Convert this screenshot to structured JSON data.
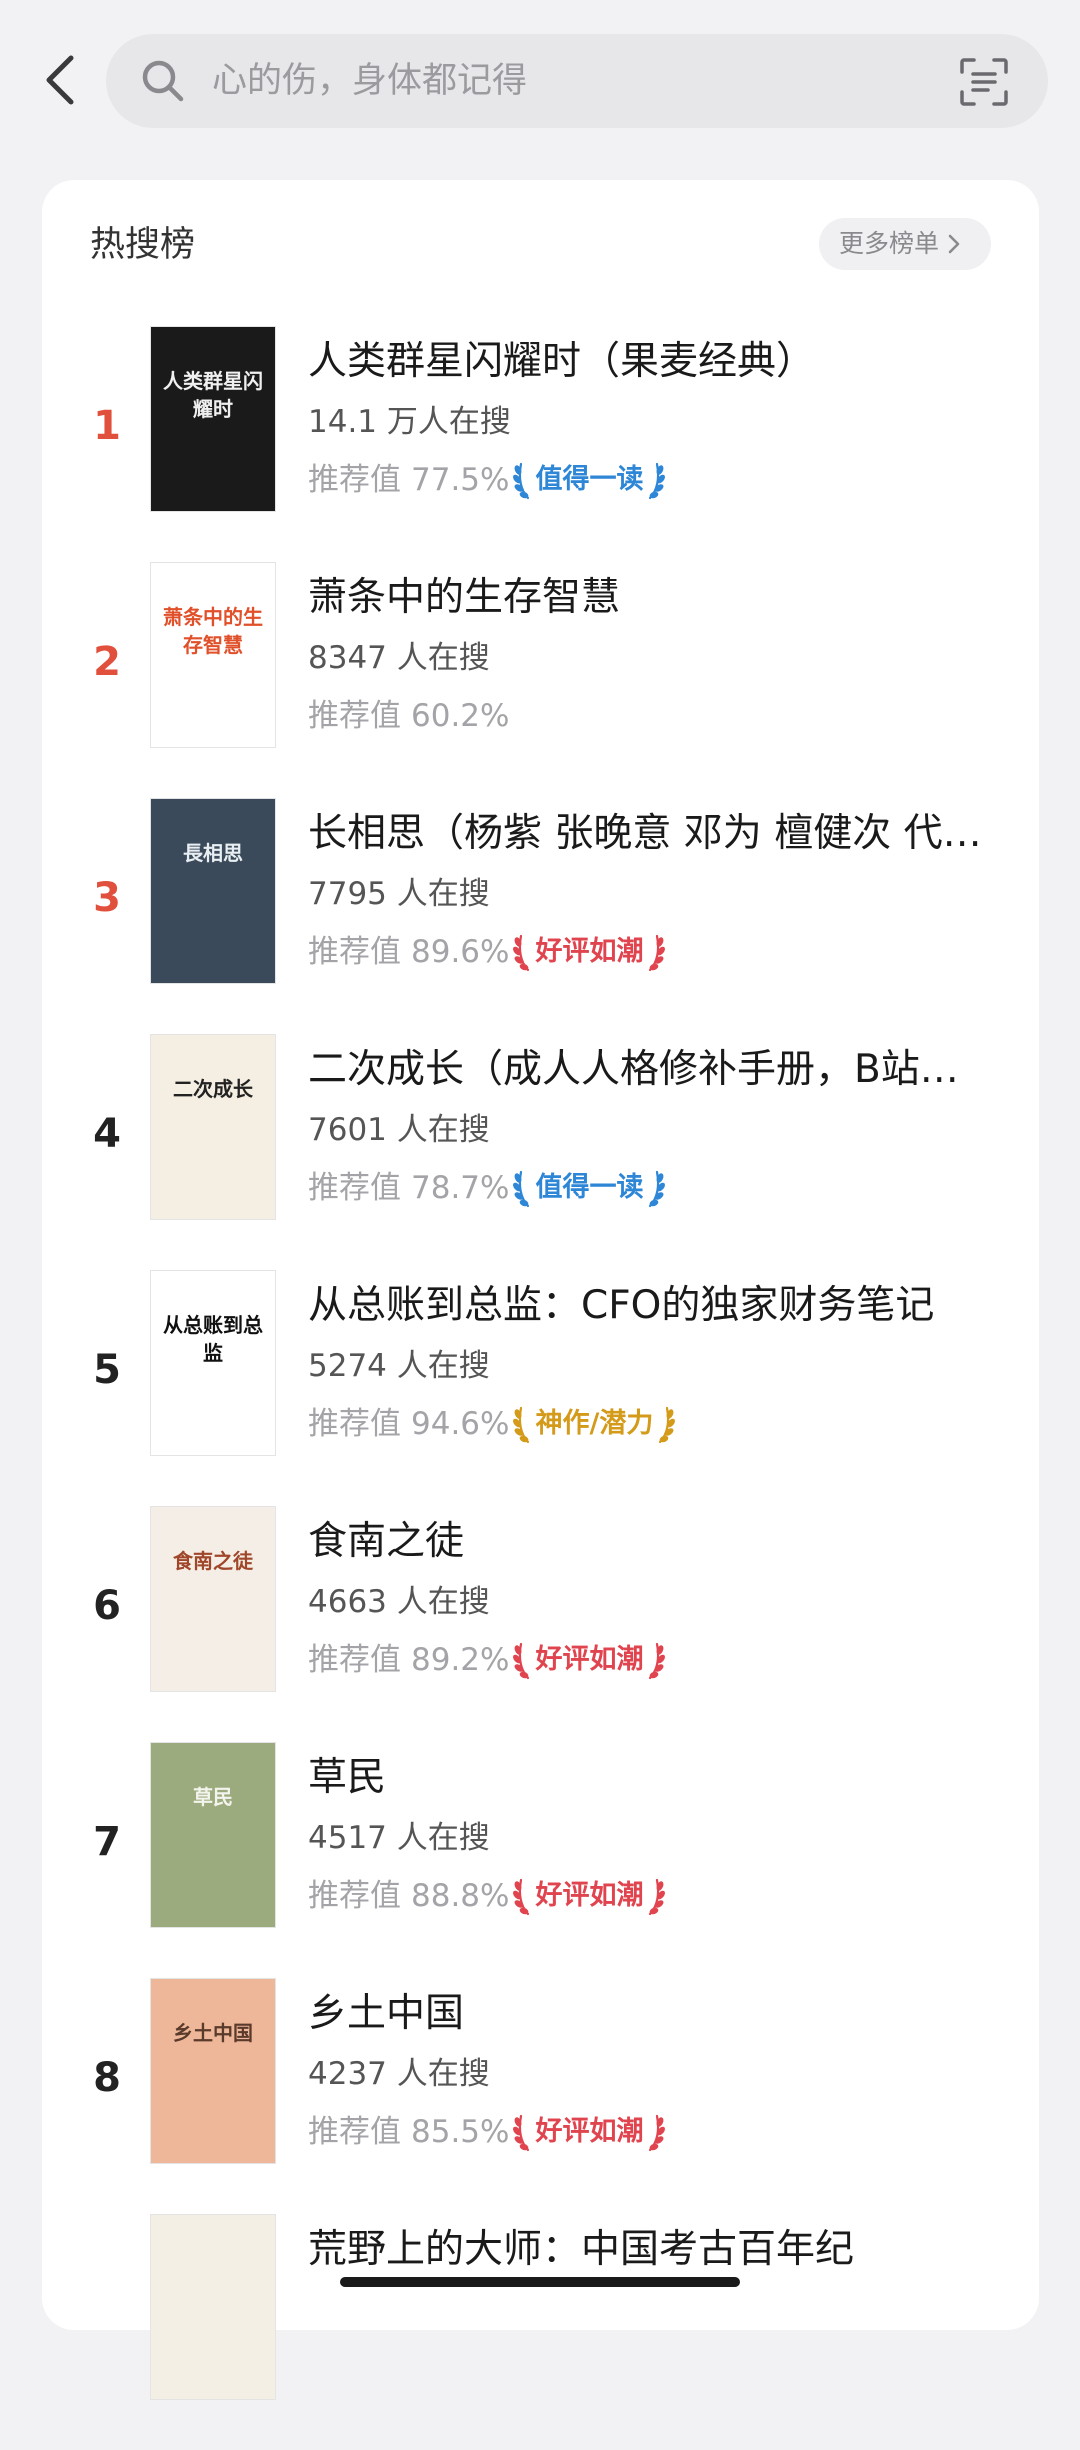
{
  "search": {
    "placeholder": "心的伤，身体都记得",
    "icons": {
      "back": "chevron-left-icon",
      "search": "search-icon",
      "scan": "scan-icon"
    }
  },
  "panel": {
    "title": "热搜榜",
    "more_label": "更多榜单"
  },
  "colors": {
    "top_rank": "#e0503c",
    "rank": "#222222",
    "badge_worth_reading": "#2e86d6",
    "badge_good_reviews": "#e0454f",
    "badge_masterpiece": "#d49a1a"
  },
  "books": [
    {
      "rank": "1",
      "title": "人类群星闪耀时（果麦经典）",
      "count": "14.1 万人在搜",
      "rec_label": "推荐值",
      "rec_value": "77.5%",
      "badge": "值得一读",
      "badge_color": "#2e86d6",
      "cover_text": "人类群星闪耀时",
      "cover_bg": "#1a1a1a",
      "cover_fg": "#f0f0f0"
    },
    {
      "rank": "2",
      "title": "萧条中的生存智慧",
      "count": "8347 人在搜",
      "rec_label": "推荐值",
      "rec_value": "60.2%",
      "badge": "",
      "badge_color": "",
      "cover_text": "萧条中的生存智慧",
      "cover_bg": "#ffffff",
      "cover_fg": "#e0502a"
    },
    {
      "rank": "3",
      "title": "长相思（杨紫 张晚意 邓为 檀健次 代…",
      "count": "7795 人在搜",
      "rec_label": "推荐值",
      "rec_value": "89.6%",
      "badge": "好评如潮",
      "badge_color": "#e0454f",
      "cover_text": "長相思",
      "cover_bg": "#3b4a5a",
      "cover_fg": "#e8eef2"
    },
    {
      "rank": "4",
      "title": "二次成长（成人人格修补手册，B站…",
      "count": "7601 人在搜",
      "rec_label": "推荐值",
      "rec_value": "78.7%",
      "badge": "值得一读",
      "badge_color": "#2e86d6",
      "cover_text": "二次成长",
      "cover_bg": "#f4efe2",
      "cover_fg": "#222222"
    },
    {
      "rank": "5",
      "title": "从总账到总监：CFO的独家财务笔记",
      "count": "5274 人在搜",
      "rec_label": "推荐值",
      "rec_value": "94.6%",
      "badge": "神作/潜力",
      "badge_color": "#d49a1a",
      "cover_text": "从总账到总监",
      "cover_bg": "#ffffff",
      "cover_fg": "#111111"
    },
    {
      "rank": "6",
      "title": "食南之徒",
      "count": "4663 人在搜",
      "rec_label": "推荐值",
      "rec_value": "89.2%",
      "badge": "好评如潮",
      "badge_color": "#e0454f",
      "cover_text": "食南之徒",
      "cover_bg": "#f4eee6",
      "cover_fg": "#a0462a"
    },
    {
      "rank": "7",
      "title": "草民",
      "count": "4517 人在搜",
      "rec_label": "推荐值",
      "rec_value": "88.8%",
      "badge": "好评如潮",
      "badge_color": "#e0454f",
      "cover_text": "草民",
      "cover_bg": "#9cab7d",
      "cover_fg": "#f4f4ee"
    },
    {
      "rank": "8",
      "title": "乡土中国",
      "count": "4237 人在搜",
      "rec_label": "推荐值",
      "rec_value": "85.5%",
      "badge": "好评如潮",
      "badge_color": "#e0454f",
      "cover_text": "乡土中国",
      "cover_bg": "#eeb79a",
      "cover_fg": "#5a3a2a"
    },
    {
      "rank": "",
      "title": "荒野上的大师：中国考古百年纪",
      "count": "",
      "rec_label": "",
      "rec_value": "",
      "badge": "",
      "badge_color": "",
      "cover_text": "",
      "cover_bg": "#f3efe4",
      "cover_fg": "#555555"
    }
  ]
}
